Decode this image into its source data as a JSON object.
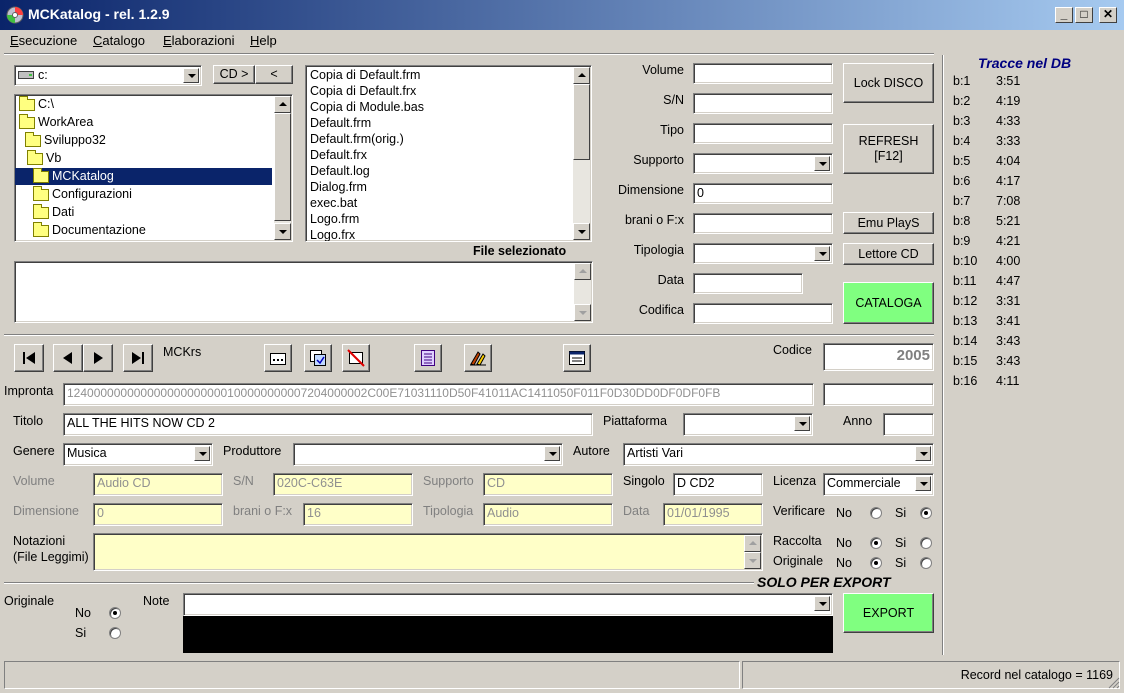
{
  "window": {
    "title": "MCKatalog - rel. 1.2.9",
    "btn_min": "_",
    "btn_max": "□",
    "btn_close": "✕"
  },
  "menu": {
    "items": [
      {
        "key": "E",
        "rest": "secuzione"
      },
      {
        "key": "C",
        "rest": "atalogo"
      },
      {
        "key": "E",
        "rest": "laborazioni"
      },
      {
        "key": "H",
        "rest": "elp"
      }
    ]
  },
  "drive": {
    "value": "c:",
    "cd_button": "CD >",
    "back_button": "<"
  },
  "tree": {
    "items": [
      "C:\\",
      "WorkArea",
      "Sviluppo32",
      "Vb",
      "MCKatalog",
      "Configurazioni",
      "Dati",
      "Documentazione"
    ]
  },
  "files": {
    "items": [
      "Copia di Default.frm",
      "Copia di Default.frx",
      "Copia di Module.bas",
      "Default.frm",
      "Default.frm(orig.)",
      "Default.frx",
      "Default.log",
      "Dialog.frm",
      "exec.bat",
      "Logo.frm",
      "Logo.frx"
    ]
  },
  "file_selected_label": "File selezionato",
  "file_selected_value": "",
  "disc": {
    "volume_label": "Volume",
    "volume": "",
    "sn_label": "S/N",
    "sn": "",
    "tipo_label": "Tipo",
    "tipo": "",
    "supporto_label": "Supporto",
    "supporto": "",
    "dimensione_label": "Dimensione",
    "dimensione": "0",
    "brani_label": "brani o  F:x",
    "brani": "",
    "tipologia_label": "Tipologia",
    "tipologia": "",
    "data_label": "Data",
    "data": "",
    "codifica_label": "Codifica",
    "codifica": ""
  },
  "buttons": {
    "lock": "Lock DISCO",
    "refresh_1": "REFRESH",
    "refresh_2": "[F12]",
    "emu": "Emu PlayS",
    "lettore": "Lettore CD",
    "cataloga": "CATALOGA",
    "export": "EXPORT"
  },
  "nav": {
    "record_label": "MCKrs"
  },
  "codice_label": "Codice",
  "codice": "2005",
  "impronta_label": "Impronta",
  "impronta": "124000000000000000000000100000000007204000002C00E71031110D50F41011AC1411050F011F0D30DD0DF0DF0FB",
  "impronta_extra": "",
  "record": {
    "titolo_label": "Titolo",
    "titolo": "ALL THE HITS NOW CD 2",
    "piattaforma_label": "Piattaforma",
    "piattaforma": "",
    "anno_label": "Anno",
    "anno": "",
    "genere_label": "Genere",
    "genere": "Musica",
    "produttore_label": "Produttore",
    "produttore": "",
    "autore_label": "Autore",
    "autore": "Artisti Vari",
    "volume_label": "Volume",
    "volume": "Audio CD",
    "sn_label": "S/N",
    "sn": "020C-C63E",
    "supporto_label": "Supporto",
    "supporto": "CD",
    "singolo_label": "Singolo",
    "singolo": "D CD2",
    "licenza_label": "Licenza",
    "licenza": "Commerciale",
    "dimensione_label": "Dimensione",
    "dimensione": "0",
    "brani_label": "brani o  F:x",
    "brani": "16",
    "tipologia_label": "Tipologia",
    "tipologia": "Audio",
    "data_label": "Data",
    "data": "01/01/1995",
    "verificare_label": "Verificare",
    "notazioni_label_1": "Notazioni",
    "notazioni_label_2": "(File Leggimi)",
    "notazioni": "",
    "raccolta_label": "Raccolta",
    "originale_label": "Originale",
    "no": "No",
    "si": "Si"
  },
  "export": {
    "banner": "SOLO PER EXPORT",
    "originale_label": "Originale",
    "no": "No",
    "si": "Si",
    "note_label": "Note",
    "note": ""
  },
  "tracks": {
    "title": "Tracce nel DB",
    "items": [
      {
        "n": "b:1",
        "t": "3:51"
      },
      {
        "n": "b:2",
        "t": "4:19"
      },
      {
        "n": "b:3",
        "t": "4:33"
      },
      {
        "n": "b:4",
        "t": "3:33"
      },
      {
        "n": "b:5",
        "t": "4:04"
      },
      {
        "n": "b:6",
        "t": "4:17"
      },
      {
        "n": "b:7",
        "t": "7:08"
      },
      {
        "n": "b:8",
        "t": "5:21"
      },
      {
        "n": "b:9",
        "t": "4:21"
      },
      {
        "n": "b:10",
        "t": "4:00"
      },
      {
        "n": "b:11",
        "t": "4:47"
      },
      {
        "n": "b:12",
        "t": "3:31"
      },
      {
        "n": "b:13",
        "t": "3:41"
      },
      {
        "n": "b:14",
        "t": "3:43"
      },
      {
        "n": "b:15",
        "t": "3:43"
      },
      {
        "n": "b:16",
        "t": "4:11"
      }
    ]
  },
  "status": {
    "left": "",
    "middle": "",
    "right": "Record nel catalogo = 1169"
  }
}
